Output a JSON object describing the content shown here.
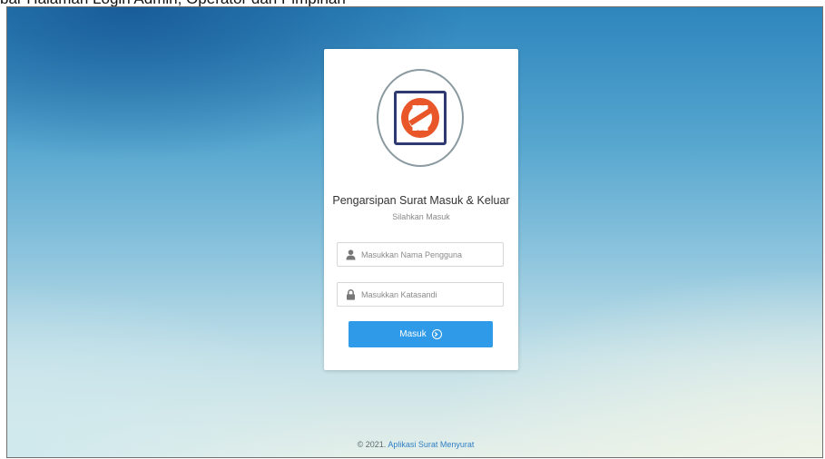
{
  "caption": "bar Halaman Login Admin, Operator dan Pimpinan",
  "app": {
    "title": "Pengarsipan Surat Masuk & Keluar",
    "subtitle": "Silahkan Masuk"
  },
  "form": {
    "username_placeholder": "Masukkan Nama Pengguna",
    "password_placeholder": "Masukkan Katasandi",
    "username_value": "",
    "password_value": "",
    "submit_label": "Masuk"
  },
  "footer": {
    "copyright": "© 2021.",
    "link_text": "Aplikasi Surat Menyurat"
  },
  "icons": {
    "user": "user-icon",
    "lock": "lock-icon",
    "submit": "circle-chevron-right-icon",
    "logo": "logo-icon"
  },
  "colors": {
    "accent": "#2f9ae8",
    "logo_orange": "#e8562a",
    "logo_navy": "#2f3a73",
    "link": "#2f7fc4"
  }
}
